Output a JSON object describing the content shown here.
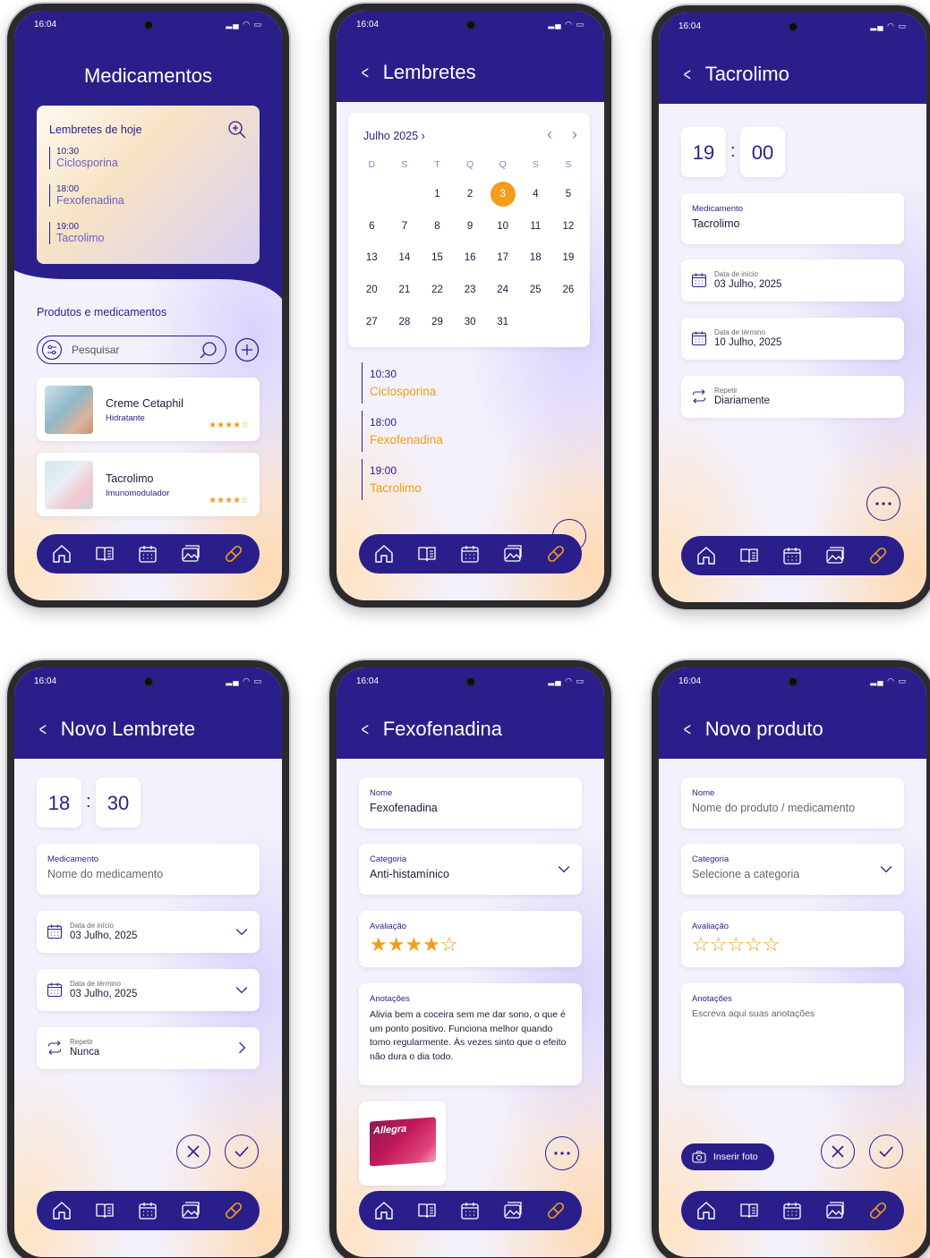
{
  "status": {
    "time": "16:04"
  },
  "nav_icons": [
    "home-icon",
    "book-icon",
    "calendar-icon",
    "gallery-icon",
    "pill-icon"
  ],
  "screen1": {
    "title": "Medicamentos",
    "today": {
      "title": "Lembretes de hoje",
      "items": [
        {
          "time": "10:30",
          "name": "Ciclosporina"
        },
        {
          "time": "18:00",
          "name": "Fexofenadina"
        },
        {
          "time": "19:00",
          "name": "Tacrolimo"
        }
      ]
    },
    "section_title": "Produtos e medicamentos",
    "search_placeholder": "Pesquisar",
    "products": [
      {
        "name": "Creme Cetaphil",
        "category": "Hidratante",
        "stars": "★★★★☆"
      },
      {
        "name": "Tacrolimo",
        "category": "Imunomodulador",
        "stars": "★★★★☆"
      }
    ]
  },
  "screen2": {
    "title": "Lembretes",
    "month": "Julho 2025",
    "weekdays": [
      "D",
      "S",
      "T",
      "Q",
      "Q",
      "S",
      "S"
    ],
    "days": [
      "",
      "",
      "1",
      "2",
      "3",
      "4",
      "5",
      "6",
      "7",
      "8",
      "9",
      "10",
      "11",
      "12",
      "13",
      "14",
      "15",
      "16",
      "17",
      "18",
      "19",
      "20",
      "21",
      "22",
      "23",
      "24",
      "25",
      "26",
      "27",
      "28",
      "29",
      "30",
      "31"
    ],
    "selected_day": "3",
    "reminders": [
      {
        "time": "10:30",
        "name": "Ciclosporina"
      },
      {
        "time": "18:00",
        "name": "Fexofenadina"
      },
      {
        "time": "19:00",
        "name": "Tacrolimo"
      }
    ]
  },
  "screen3": {
    "title": "Tacrolimo",
    "hour": "19",
    "minute": "00",
    "sep": ":",
    "med_label": "Medicamento",
    "med_value": "Tacrolimo",
    "start_label": "Data de início",
    "start_value": "03 Julho, 2025",
    "end_label": "Data de término",
    "end_value": "10 Julho, 2025",
    "repeat_label": "Repetir",
    "repeat_value": "Diariamente"
  },
  "screen4": {
    "title": "Novo Lembrete",
    "hour": "18",
    "minute": "30",
    "sep": ":",
    "med_label": "Medicamento",
    "med_placeholder": "Nome do medicamento",
    "start_label": "Data de início",
    "start_value": "03 Julho, 2025",
    "end_label": "Data de término",
    "end_value": "03 Julho, 2025",
    "repeat_label": "Repetir",
    "repeat_value": "Nunca"
  },
  "screen5": {
    "title": "Fexofenadina",
    "name_label": "Nome",
    "name_value": "Fexofenadina",
    "cat_label": "Categoria",
    "cat_value": "Anti-histamínico",
    "rating_label": "Avaliação",
    "rating_stars": "★★★★☆",
    "notes_label": "Anotações",
    "notes_value": "Alivia bem a coceira sem me dar sono, o que é um ponto positivo. Funciona melhor quando tomo regularmente. Às vezes sinto que o efeito não dura o dia todo.",
    "photo_brand": "Allegra"
  },
  "screen6": {
    "title": "Novo produto",
    "name_label": "Nome",
    "name_placeholder": "Nome do produto / medicamento",
    "cat_label": "Categoria",
    "cat_placeholder": "Selecione a categoria",
    "rating_label": "Avaliação",
    "rating_stars": "☆☆☆☆☆",
    "notes_label": "Anotações",
    "notes_placeholder": "Escreva aqui suas anotações",
    "photo_button": "Inserir foto"
  }
}
